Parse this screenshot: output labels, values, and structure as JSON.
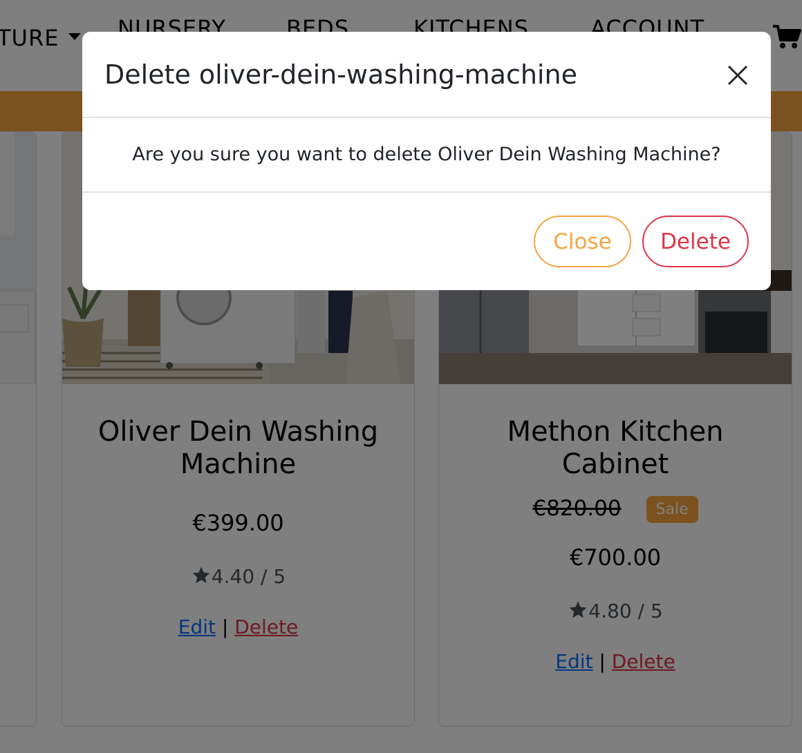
{
  "navbar": {
    "items": [
      {
        "label": "TURE"
      },
      {
        "label": "NURSERY"
      },
      {
        "label": "BEDS"
      },
      {
        "label": "KITCHENS"
      },
      {
        "label": "ACCOUNT"
      }
    ],
    "cart_icon": "shopping-cart-icon"
  },
  "colors": {
    "accent": "#f6a43f",
    "danger": "#dc3545",
    "link": "#0d6efd"
  },
  "products": [
    {
      "title": "Oliver Dein Washing Machine",
      "price": "€399.00",
      "rating_value": "4.40",
      "rating_max": "/ 5",
      "edit_label": "Edit",
      "separator": "|",
      "delete_label": "Delete"
    },
    {
      "title": "Methon Kitchen Cabinet",
      "old_price": "€820.00",
      "badge": "Sale",
      "price": "€700.00",
      "rating_value": "4.80",
      "rating_max": "/ 5",
      "edit_label": "Edit",
      "separator": "|",
      "delete_label": "Delete"
    }
  ],
  "modal": {
    "title": "Delete oliver-dein-washing-machine",
    "body": "Are you sure you want to delete Oliver Dein Washing Machine?",
    "close_label": "Close",
    "delete_label": "Delete"
  }
}
